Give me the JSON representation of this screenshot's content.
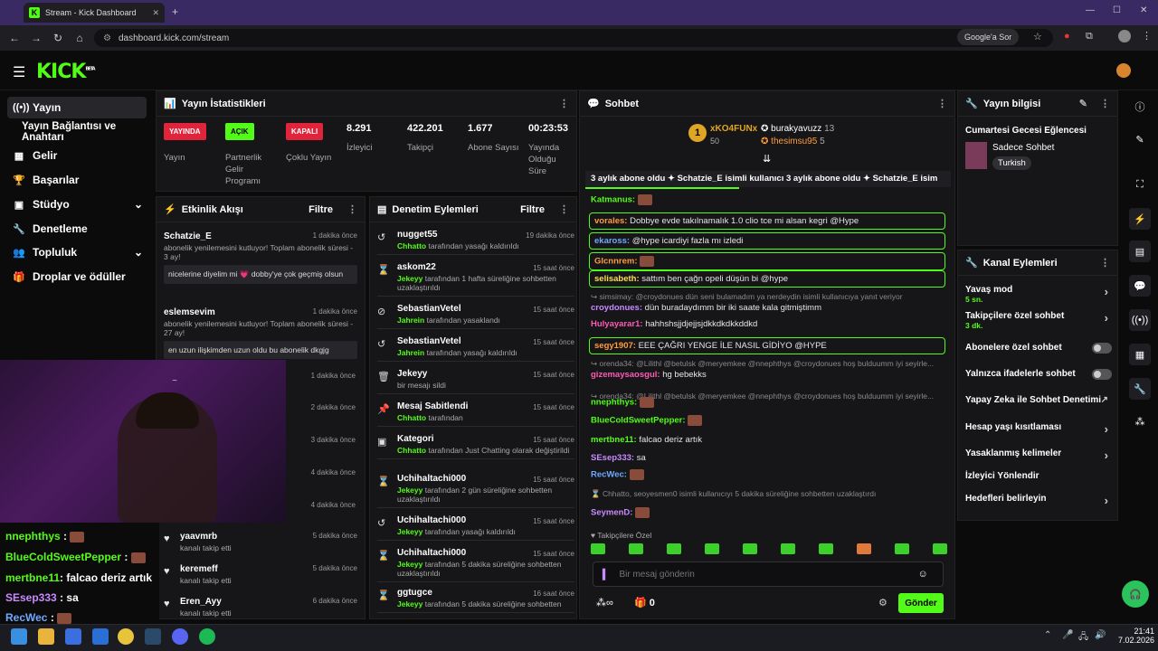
{
  "browser": {
    "tab_title": "Stream - Kick Dashboard",
    "url": "dashboard.kick.com/stream",
    "google_search": "Google'a Sor"
  },
  "app": {
    "logo": "KICK",
    "logo_sup": "BETA"
  },
  "nav": {
    "items": [
      {
        "label": "Yayın",
        "icon": "broadcast-icon"
      },
      {
        "label": "Yayın Bağlantısı ve Anahtarı",
        "icon": ""
      },
      {
        "label": "Gelir",
        "icon": "revenue-icon"
      },
      {
        "label": "Başarılar",
        "icon": "trophy-icon"
      },
      {
        "label": "Stüdyo",
        "icon": "studio-icon"
      },
      {
        "label": "Denetleme",
        "icon": "wrench-icon"
      },
      {
        "label": "Topluluk",
        "icon": "community-icon"
      },
      {
        "label": "Droplar ve ödüller",
        "icon": "gift-icon"
      }
    ]
  },
  "stats": {
    "title": "Yayın İstatistikleri",
    "live_badge": "YAYINDA",
    "live_label": "Yayın",
    "partner_badge": "AÇIK",
    "partner_label": "Partnerlik Gelir Programı",
    "multi_badge": "KAPALI",
    "multi_label": "Çoklu Yayın",
    "viewers": "8.291",
    "viewers_label": "İzleyici",
    "followers": "422.201",
    "followers_label": "Takipçi",
    "subs": "1.677",
    "subs_label": "Abone Sayısı",
    "uptime": "00:23:53",
    "uptime_label": "Yayında Olduğu Süre"
  },
  "activity": {
    "title": "Etkinlik Akışı",
    "filter": "Filtre",
    "items": [
      {
        "user": "Schatzie_E",
        "time": "1 dakika önce",
        "desc": "abonelik yenilemesini kutluyor! Toplam abonelik süresi - 3 ay!",
        "msg": "nicelerine diyelim mi 💗 dobby'ye çok geçmiş olsun"
      },
      {
        "user": "eslemsevim",
        "time": "1 dakika önce",
        "desc": "abonelik yenilemesini kutluyor! Toplam abonelik süresi - 27 ay!",
        "msg": "en uzun ilişkimden uzun oldu bu abonelik dkgjg"
      }
    ],
    "times": [
      "1 dakika önce",
      "2 dakika önce",
      "3 dakika önce",
      "4 dakika önce",
      "4 dakika önce"
    ],
    "follows": [
      {
        "user": "yaavmrb",
        "desc": "kanalı takip etti",
        "time": "5 dakika önce"
      },
      {
        "user": "keremeff",
        "desc": "kanalı takip etti",
        "time": "5 dakika önce"
      },
      {
        "user": "Eren_Ayy",
        "desc": "kanalı takip etti",
        "time": "6 dakika önce"
      }
    ]
  },
  "moderation": {
    "title": "Denetim Eylemleri",
    "filter": "Filtre",
    "items": [
      {
        "user": "nugget55",
        "time": "19 dakika önce",
        "by": "Chhatto",
        "desc": "tarafından yasağı kaldırıldı",
        "icon": "unban-icon"
      },
      {
        "user": "askom22",
        "time": "15 saat önce",
        "by": "Jekeyy",
        "desc": "tarafından 1 hafta süreliğine sohbetten uzaklaştırıldı",
        "icon": "hourglass-icon"
      },
      {
        "user": "SebastianVetel",
        "time": "15 saat önce",
        "by": "Jahrein",
        "desc": "tarafından yasaklandı",
        "icon": "ban-icon"
      },
      {
        "user": "SebastianVetel",
        "time": "15 saat önce",
        "by": "Jahrein",
        "desc": "tarafından yasağı kaldırıldı",
        "icon": "unban-icon"
      },
      {
        "user": "Jekeyy",
        "time": "15 saat önce",
        "by": "",
        "desc": "bir mesajı sildi",
        "icon": "trash-icon"
      },
      {
        "user": "Mesaj Sabitlendi",
        "time": "15 saat önce",
        "by": "Chhatto",
        "desc": "tarafından",
        "icon": "pin-icon"
      },
      {
        "user": "Kategori",
        "time": "15 saat önce",
        "by": "Chhatto",
        "desc": "tarafından Just Chatting olarak değiştirildi",
        "icon": "category-icon"
      },
      {
        "user": "Uchihaltachi000",
        "time": "15 saat önce",
        "by": "Jekeyy",
        "desc": "tarafından 2 gün süreliğine sohbetten uzaklaştırıldı",
        "icon": "hourglass-icon"
      },
      {
        "user": "Uchihaltachi000",
        "time": "15 saat önce",
        "by": "Jekeyy",
        "desc": "tarafından yasağı kaldırıldı",
        "icon": "unban-icon"
      },
      {
        "user": "Uchihaltachi000",
        "time": "15 saat önce",
        "by": "Jekeyy",
        "desc": "tarafından 5 dakika süreliğine sohbetten uzaklaştırıldı",
        "icon": "hourglass-icon"
      },
      {
        "user": "ggtugce",
        "time": "16 saat önce",
        "by": "Jekeyy",
        "desc": "tarafından 5 dakika süreliğine sohbetten",
        "icon": "hourglass-icon"
      }
    ]
  },
  "chat": {
    "title": "Sohbet",
    "leader1": {
      "rank": "1",
      "name": "xKO4FUNx",
      "score": "50"
    },
    "leader2": {
      "name": "burakyavuzz",
      "score": "13"
    },
    "leader3": {
      "name": "thesimsu95",
      "score": "5"
    },
    "ticker": "3 aylık abone oldu ✦ Schatzie_E isimli kullanıcı 3 aylık abone oldu ✦ Schatzie_E isim",
    "lines": [
      {
        "user": "Katmanus:",
        "text": "",
        "color": "#53fc18",
        "hl": false
      },
      {
        "user": "vorales:",
        "text": " Dobbye evde takılnamalık 1.0 clio tce mi alsan kegri @Hype",
        "color": "#ff9d3c",
        "hl": true
      },
      {
        "user": "ekaross:",
        "text": " @hype icardiyi fazla mı izledi",
        "color": "#6fa8ff",
        "hl": true
      },
      {
        "user": "Glcnnrem:",
        "text": "",
        "color": "#ff9d3c",
        "hl": true
      },
      {
        "user": "selisabeth:",
        "text": " sattım ben çağn opeli düşün bi @hype",
        "color": "#f5e048",
        "hl": true
      },
      {
        "user": "",
        "text": "↪ simsimay: @croydonues dün seni bulamadım ya nerdeydin isimli kullanıcıya yanıt veriyor",
        "color": "#8a8a8f",
        "hl": false
      },
      {
        "user": "croydonues:",
        "text": " dün buradaydımm bir iki saate kala gitmiştimm",
        "color": "#c78bff",
        "hl": false
      },
      {
        "user": "Hulyayarar1:",
        "text": " hahhshsjjdjejjsjdkkdkdkkddkd",
        "color": "#ff5ab4",
        "hl": false
      },
      {
        "user": "segy1907:",
        "text": " EEE ÇAĞRI YENGE İLE NASIL GİDİYO @HYPE",
        "color": "#ff9d3c",
        "hl": true
      },
      {
        "user": "",
        "text": "↪ orenda34: @Lilithl @betulsk @meryemkee @nnephthys @croydonues hoş bulduumm iyi seyirle...",
        "color": "#8a8a8f",
        "hl": false
      },
      {
        "user": "gizemaysaosgul:",
        "text": " hg bebekks",
        "color": "#ff5ab4",
        "hl": false
      },
      {
        "user": "",
        "text": "↪ orenda34: @Lilithl @betulsk @meryemkee @nnephthys @croydonues hoş bulduumm iyi seyirle...",
        "color": "#8a8a8f",
        "hl": false
      },
      {
        "user": "nnephthys:",
        "text": "",
        "color": "#53fc18",
        "hl": false
      },
      {
        "user": "BlueColdSweetPepper:",
        "text": "",
        "color": "#53fc18",
        "hl": false
      },
      {
        "user": "mertbne11:",
        "text": " falcao deriz artık",
        "color": "#53fc18",
        "hl": false
      },
      {
        "user": "SEsep333:",
        "text": " sa",
        "color": "#c78bff",
        "hl": false
      },
      {
        "user": "RecWec:",
        "text": "",
        "color": "#6fa8ff",
        "hl": false
      },
      {
        "user": "",
        "text": "⌛ Chhatto, seoyesmen0 isimli kullanıcıyı 5 dakika süreliğine sohbetten uzaklaştırdı",
        "color": "#8a8a8f",
        "hl": false
      },
      {
        "user": "SeymenD:",
        "text": "",
        "color": "#c78bff",
        "hl": false
      }
    ],
    "followers_only": "Takipçilere Özel",
    "input_placeholder": "Bir mesaj gönderin",
    "count": "0",
    "send": "Gönder"
  },
  "info": {
    "title": "Yayın bilgisi",
    "stream_title": "Cumartesi Gecesi Eğlencesi",
    "category": "Sadece Sohbet",
    "tag": "Turkish"
  },
  "channel": {
    "title": "Kanal Eylemleri",
    "slow": "Yavaş mod",
    "slow_val": "5 sn.",
    "followers_chat": "Takipçilere özel sohbet",
    "followers_val": "3 dk.",
    "subs_chat": "Abonelere özel sohbet",
    "emote_chat": "Yalnızca ifadelerle sohbet",
    "ai_mod": "Yapay Zeka ile Sohbet Denetimi",
    "age": "Hesap yaşı kısıtlaması",
    "banned_words": "Yasaklanmış kelimeler",
    "raid": "İzleyici Yönlendir",
    "goals": "Hedefleri belirleyin"
  },
  "overlay": {
    "lines": [
      {
        "user": "nnephthys",
        "text": ":",
        "color": "#53fc18"
      },
      {
        "user": "BlueColdSweetPepper",
        "text": ":",
        "color": "#53fc18"
      },
      {
        "user": "mertbne11",
        "text": ": falcao deriz artık",
        "color": "#53fc18"
      },
      {
        "user": "SEsep333",
        "text": ": sa",
        "color": "#c78bff"
      },
      {
        "user": "RecWec",
        "text": ":",
        "color": "#6fa8ff"
      }
    ]
  },
  "clock": {
    "time": "21:41",
    "date": "7.02.2026"
  },
  "colors": {
    "accent": "#53fc18",
    "live": "#e0243b",
    "chrome": "#3a2a63"
  }
}
